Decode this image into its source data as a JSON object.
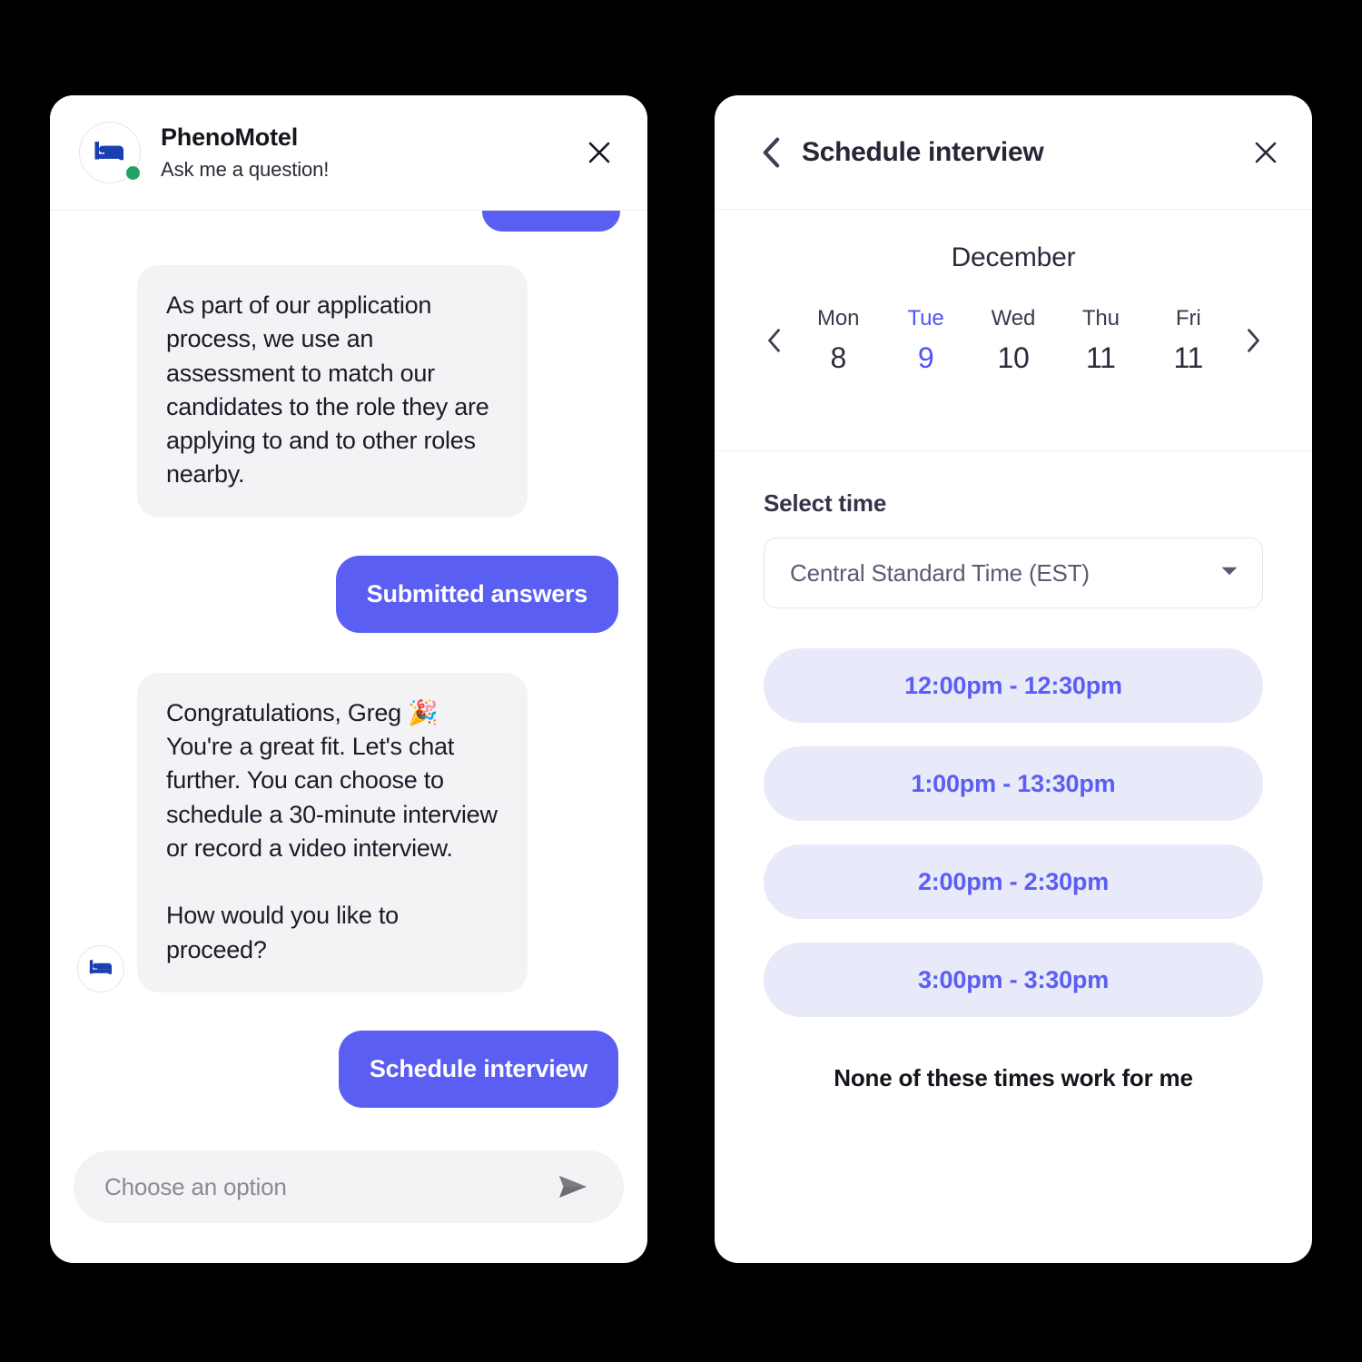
{
  "chat_panel": {
    "header": {
      "title": "PhenoMotel",
      "subtitle": "Ask me a question!",
      "avatar_icon": "bed-icon",
      "status": "online",
      "close_icon": "close-icon"
    },
    "messages": [
      {
        "sender": "bot",
        "text": "As part of our application process, we use an assessment to match our candidates to the role they are applying to and to other roles nearby."
      },
      {
        "sender": "user",
        "text": "Submitted answers"
      },
      {
        "sender": "bot",
        "text": "Congratulations, Greg 🎉\nYou're a great fit. Let's chat further. You can choose to schedule a 30-minute interview or record a video interview.\n\nHow would you like to proceed?"
      },
      {
        "sender": "user",
        "text": "Schedule interview"
      }
    ],
    "composer": {
      "placeholder": "Choose an option",
      "value": "",
      "send_icon": "send-icon"
    }
  },
  "scheduler_panel": {
    "header": {
      "back_icon": "chevron-left-icon",
      "title": "Schedule interview",
      "close_icon": "close-icon"
    },
    "calendar": {
      "month": "December",
      "prev_icon": "chevron-left-icon",
      "next_icon": "chevron-right-icon",
      "days": [
        {
          "dow": "Mon",
          "date": "8",
          "selected": false
        },
        {
          "dow": "Tue",
          "date": "9",
          "selected": true
        },
        {
          "dow": "Wed",
          "date": "10",
          "selected": false
        },
        {
          "dow": "Thu",
          "date": "11",
          "selected": false
        },
        {
          "dow": "Fri",
          "date": "11",
          "selected": false
        }
      ]
    },
    "time_section": {
      "label": "Select time",
      "timezone_value": "Central Standard Time (EST)",
      "caret_icon": "chevron-down-icon",
      "slots": [
        "12:00pm  - 12:30pm",
        "1:00pm - 13:30pm",
        "2:00pm - 2:30pm",
        "3:00pm - 3:30pm"
      ],
      "none_option": "None of these times work for me"
    }
  },
  "colors": {
    "accent": "#5a5ef2",
    "slot_bg": "#e8eaf9",
    "bubble_bg": "#f3f3f6",
    "status_green": "#21a366",
    "icon_blue": "#1a3fb0",
    "page_bg": "#000000"
  }
}
